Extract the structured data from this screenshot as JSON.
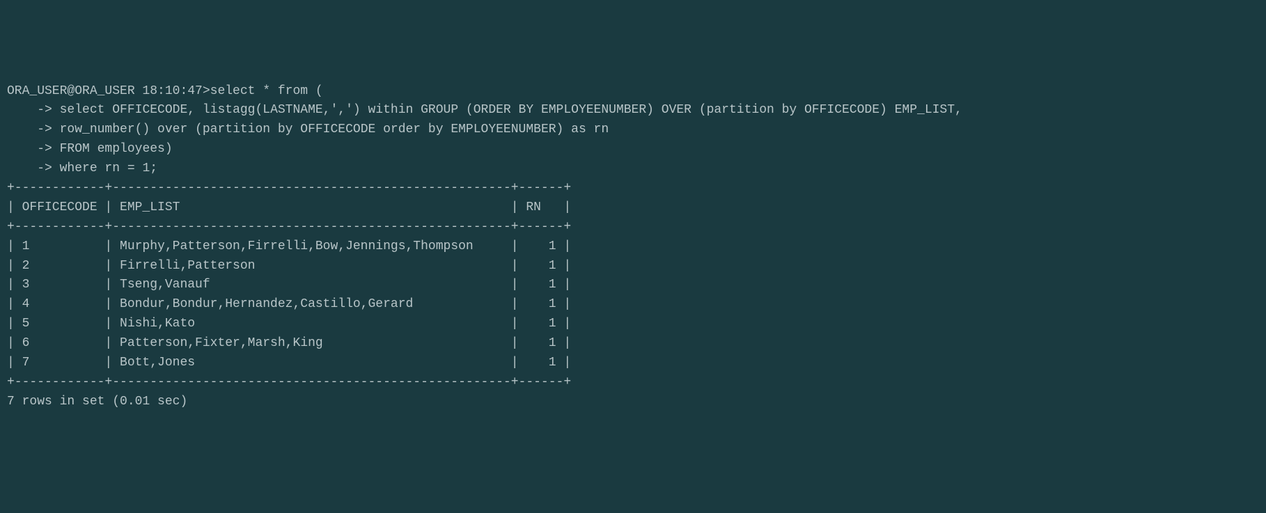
{
  "prompt": "ORA_USER@ORA_USER 18:10:47>",
  "query": {
    "line1": "select * from (",
    "cont_prefix": "    -> ",
    "line2": "select OFFICECODE, listagg(LASTNAME,',') within GROUP (ORDER BY EMPLOYEENUMBER) OVER (partition by OFFICECODE) EMP_LIST,",
    "line3": "row_number() over (partition by OFFICECODE order by EMPLOYEENUMBER) as rn",
    "line4": "FROM employees)",
    "line5": "where rn = 1;"
  },
  "table": {
    "border": "+------------+-----------------------------------------------------+------+",
    "header": "| OFFICECODE | EMP_LIST                                            | RN   |",
    "rows": [
      "| 1          | Murphy,Patterson,Firrelli,Bow,Jennings,Thompson     |    1 |",
      "| 2          | Firrelli,Patterson                                  |    1 |",
      "| 3          | Tseng,Vanauf                                        |    1 |",
      "| 4          | Bondur,Bondur,Hernandez,Castillo,Gerard             |    1 |",
      "| 5          | Nishi,Kato                                          |    1 |",
      "| 6          | Patterson,Fixter,Marsh,King                         |    1 |",
      "| 7          | Bott,Jones                                          |    1 |"
    ]
  },
  "status": "7 rows in set (0.01 sec)",
  "chart_data": {
    "type": "table",
    "columns": [
      "OFFICECODE",
      "EMP_LIST",
      "RN"
    ],
    "rows": [
      {
        "OFFICECODE": "1",
        "EMP_LIST": "Murphy,Patterson,Firrelli,Bow,Jennings,Thompson",
        "RN": 1
      },
      {
        "OFFICECODE": "2",
        "EMP_LIST": "Firrelli,Patterson",
        "RN": 1
      },
      {
        "OFFICECODE": "3",
        "EMP_LIST": "Tseng,Vanauf",
        "RN": 1
      },
      {
        "OFFICECODE": "4",
        "EMP_LIST": "Bondur,Bondur,Hernandez,Castillo,Gerard",
        "RN": 1
      },
      {
        "OFFICECODE": "5",
        "EMP_LIST": "Nishi,Kato",
        "RN": 1
      },
      {
        "OFFICECODE": "6",
        "EMP_LIST": "Patterson,Fixter,Marsh,King",
        "RN": 1
      },
      {
        "OFFICECODE": "7",
        "EMP_LIST": "Bott,Jones",
        "RN": 1
      }
    ],
    "row_count": 7,
    "elapsed_sec": 0.01
  }
}
